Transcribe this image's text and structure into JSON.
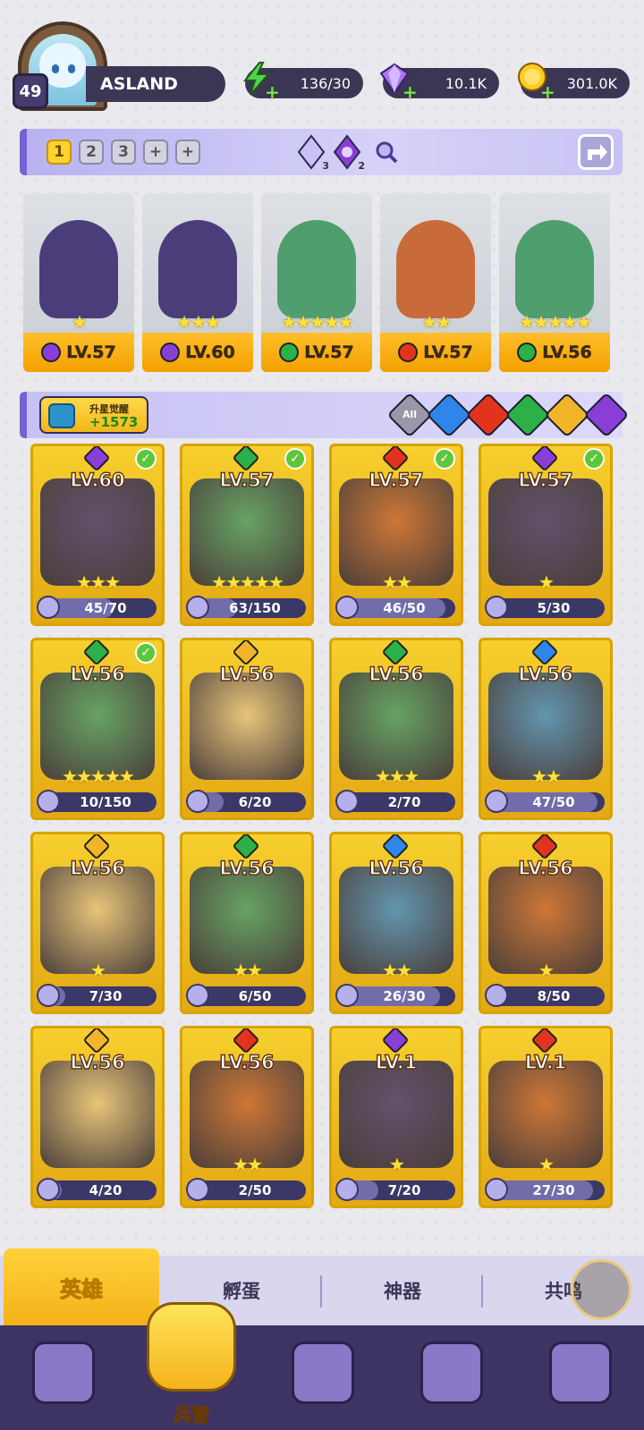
{
  "player": {
    "level": "49",
    "name": "ASLAND"
  },
  "resources": [
    {
      "icon": "energy-icon",
      "value": "136/30"
    },
    {
      "icon": "gem-icon",
      "value": "10.1K"
    },
    {
      "icon": "coin-icon",
      "value": "301.0K"
    }
  ],
  "team_bar": {
    "slots": [
      "1",
      "2",
      "3",
      "+",
      "+"
    ],
    "crystals": [
      {
        "icon": "crystal-icon",
        "count": "3"
      },
      {
        "icon": "dark-crystal-icon",
        "count": "2"
      }
    ]
  },
  "team": [
    {
      "level": "LV.57",
      "element": "dark",
      "stars": 1
    },
    {
      "level": "LV.60",
      "element": "dark",
      "stars": 3
    },
    {
      "level": "LV.57",
      "element": "nature",
      "stars": 5
    },
    {
      "level": "LV.57",
      "element": "fire",
      "stars": 2
    },
    {
      "level": "LV.56",
      "element": "nature",
      "stars": 5
    }
  ],
  "filter_bar": {
    "star_label": "升星觉醒",
    "star_value": "+1573",
    "filters": [
      "All",
      "water",
      "fire",
      "nature",
      "light",
      "dark"
    ],
    "all_label": "All"
  },
  "colors": {
    "water": "#2f86e8",
    "fire": "#e2331c",
    "nature": "#2bb04a",
    "light": "#f2b52a",
    "dark": "#8a3ed8"
  },
  "heroes": [
    {
      "level": "LV.60",
      "element": "dark",
      "checked": true,
      "stars": 3,
      "progress": "45/70",
      "fill": 0.64
    },
    {
      "level": "LV.57",
      "element": "nature",
      "checked": true,
      "stars": 5,
      "progress": "63/150",
      "fill": 0.42
    },
    {
      "level": "LV.57",
      "element": "fire",
      "checked": true,
      "stars": 2,
      "progress": "46/50",
      "fill": 0.92
    },
    {
      "level": "LV.57",
      "element": "dark",
      "checked": true,
      "stars": 1,
      "progress": "5/30",
      "fill": 0.17
    },
    {
      "level": "LV.56",
      "element": "nature",
      "checked": true,
      "stars": 5,
      "progress": "10/150",
      "fill": 0.07
    },
    {
      "level": "LV.56",
      "element": "light",
      "checked": false,
      "stars": 0,
      "progress": "6/20",
      "fill": 0.3
    },
    {
      "level": "LV.56",
      "element": "nature",
      "checked": false,
      "stars": 3,
      "progress": "2/70",
      "fill": 0.03
    },
    {
      "level": "LV.56",
      "element": "water",
      "checked": false,
      "stars": 2,
      "progress": "47/50",
      "fill": 0.94
    },
    {
      "level": "LV.56",
      "element": "light",
      "checked": false,
      "stars": 1,
      "progress": "7/30",
      "fill": 0.23
    },
    {
      "level": "LV.56",
      "element": "nature",
      "checked": false,
      "stars": 2,
      "progress": "6/50",
      "fill": 0.12
    },
    {
      "level": "LV.56",
      "element": "water",
      "checked": false,
      "stars": 2,
      "progress": "26/30",
      "fill": 0.87
    },
    {
      "level": "LV.56",
      "element": "fire",
      "checked": false,
      "stars": 1,
      "progress": "8/50",
      "fill": 0.16
    },
    {
      "level": "LV.56",
      "element": "light",
      "checked": false,
      "stars": 0,
      "progress": "4/20",
      "fill": 0.2
    },
    {
      "level": "LV.56",
      "element": "fire",
      "checked": false,
      "stars": 2,
      "progress": "2/50",
      "fill": 0.04
    },
    {
      "level": "LV.1",
      "element": "dark",
      "checked": false,
      "stars": 1,
      "progress": "7/20",
      "fill": 0.35
    },
    {
      "level": "LV.1",
      "element": "fire",
      "checked": false,
      "stars": 1,
      "progress": "27/30",
      "fill": 0.9
    }
  ],
  "tabs": [
    "英雄",
    "孵蛋",
    "神器",
    "共鸣"
  ],
  "nav": {
    "selected_label": "兵营",
    "icons": [
      "cards-icon",
      "barracks-icon",
      "map-icon",
      "castle-icon",
      "mushroom-icon"
    ]
  }
}
